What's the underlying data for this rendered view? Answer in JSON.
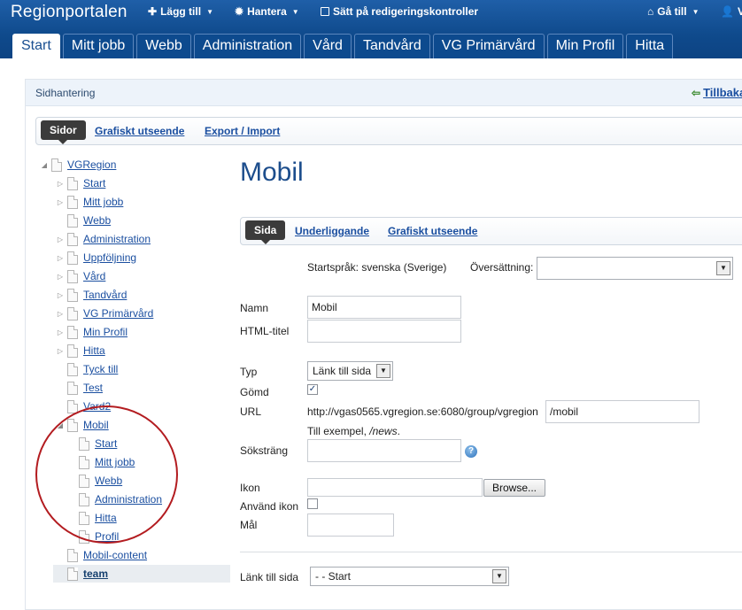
{
  "dock": {
    "brand": "Regionportalen",
    "menus": [
      {
        "label": "Lägg till",
        "icon": "plus-icon"
      },
      {
        "label": "Hantera",
        "icon": "gear-icon"
      },
      {
        "label": "Sätt på redigeringskontroller",
        "icon": "checkbox-icon"
      },
      {
        "label": "Gå till",
        "icon": "home-icon"
      },
      {
        "label": "V",
        "icon": "user-icon"
      }
    ],
    "tabs": [
      "Start",
      "Mitt jobb",
      "Webb",
      "Administration",
      "Vård",
      "Tandvård",
      "VG Primärvård",
      "Min Profil",
      "Hitta"
    ],
    "active_tab": "Start"
  },
  "panel": {
    "title": "Sidhantering",
    "back_link": "Tillbaka",
    "subnav": {
      "active": "Sidor",
      "links": [
        "Grafiskt utseende",
        "Export / Import"
      ]
    }
  },
  "tree": {
    "root": "VGRegion",
    "children": [
      "Start",
      "Mitt jobb",
      "Webb",
      "Administration",
      "Uppföljning",
      "Vård",
      "Tandvård",
      "VG Primärvård",
      "Min Profil",
      "Hitta",
      "Tyck till",
      "Test",
      "Vard2",
      "Mobil"
    ],
    "mobil_children": [
      "Start",
      "Mitt jobb",
      "Webb",
      "Administration",
      "Hitta",
      "Profil"
    ],
    "after": [
      "Mobil-content",
      "team"
    ],
    "selected": "team"
  },
  "form": {
    "heading": "Mobil",
    "tabs": {
      "active": "Sida",
      "links": [
        "Underliggande",
        "Grafiskt utseende"
      ]
    },
    "language_label": "Startspråk: svenska (Sverige)",
    "translation_label": "Översättning:",
    "translation_value": "",
    "name_label": "Namn",
    "name_value": "Mobil",
    "html_title_label": "HTML-titel",
    "html_title_value": "",
    "type_label": "Typ",
    "type_value": "Länk till sida",
    "hidden_label": "Gömd",
    "hidden_checked": true,
    "url_label": "URL",
    "url_prefix": "http://vgas0565.vgregion.se:6080/group/vgregion",
    "url_value": "/mobil",
    "url_example_prefix": "Till exempel, ",
    "url_example_value": "/news",
    "url_example_suffix": ".",
    "search_label": "Söksträng",
    "search_value": "",
    "icon_label": "Ikon",
    "icon_file_value": "",
    "browse_label": "Browse...",
    "use_icon_label": "Använd ikon",
    "use_icon_checked": false,
    "target_label": "Mål",
    "target_value": "",
    "link_to_page_label": "Länk till sida",
    "link_to_page_value": "- - Start"
  },
  "colors": {
    "dock": "#0f4a8c",
    "link": "#1b4fa0",
    "heading": "#1c4d8c",
    "annotation_circle": "#b31c20"
  }
}
